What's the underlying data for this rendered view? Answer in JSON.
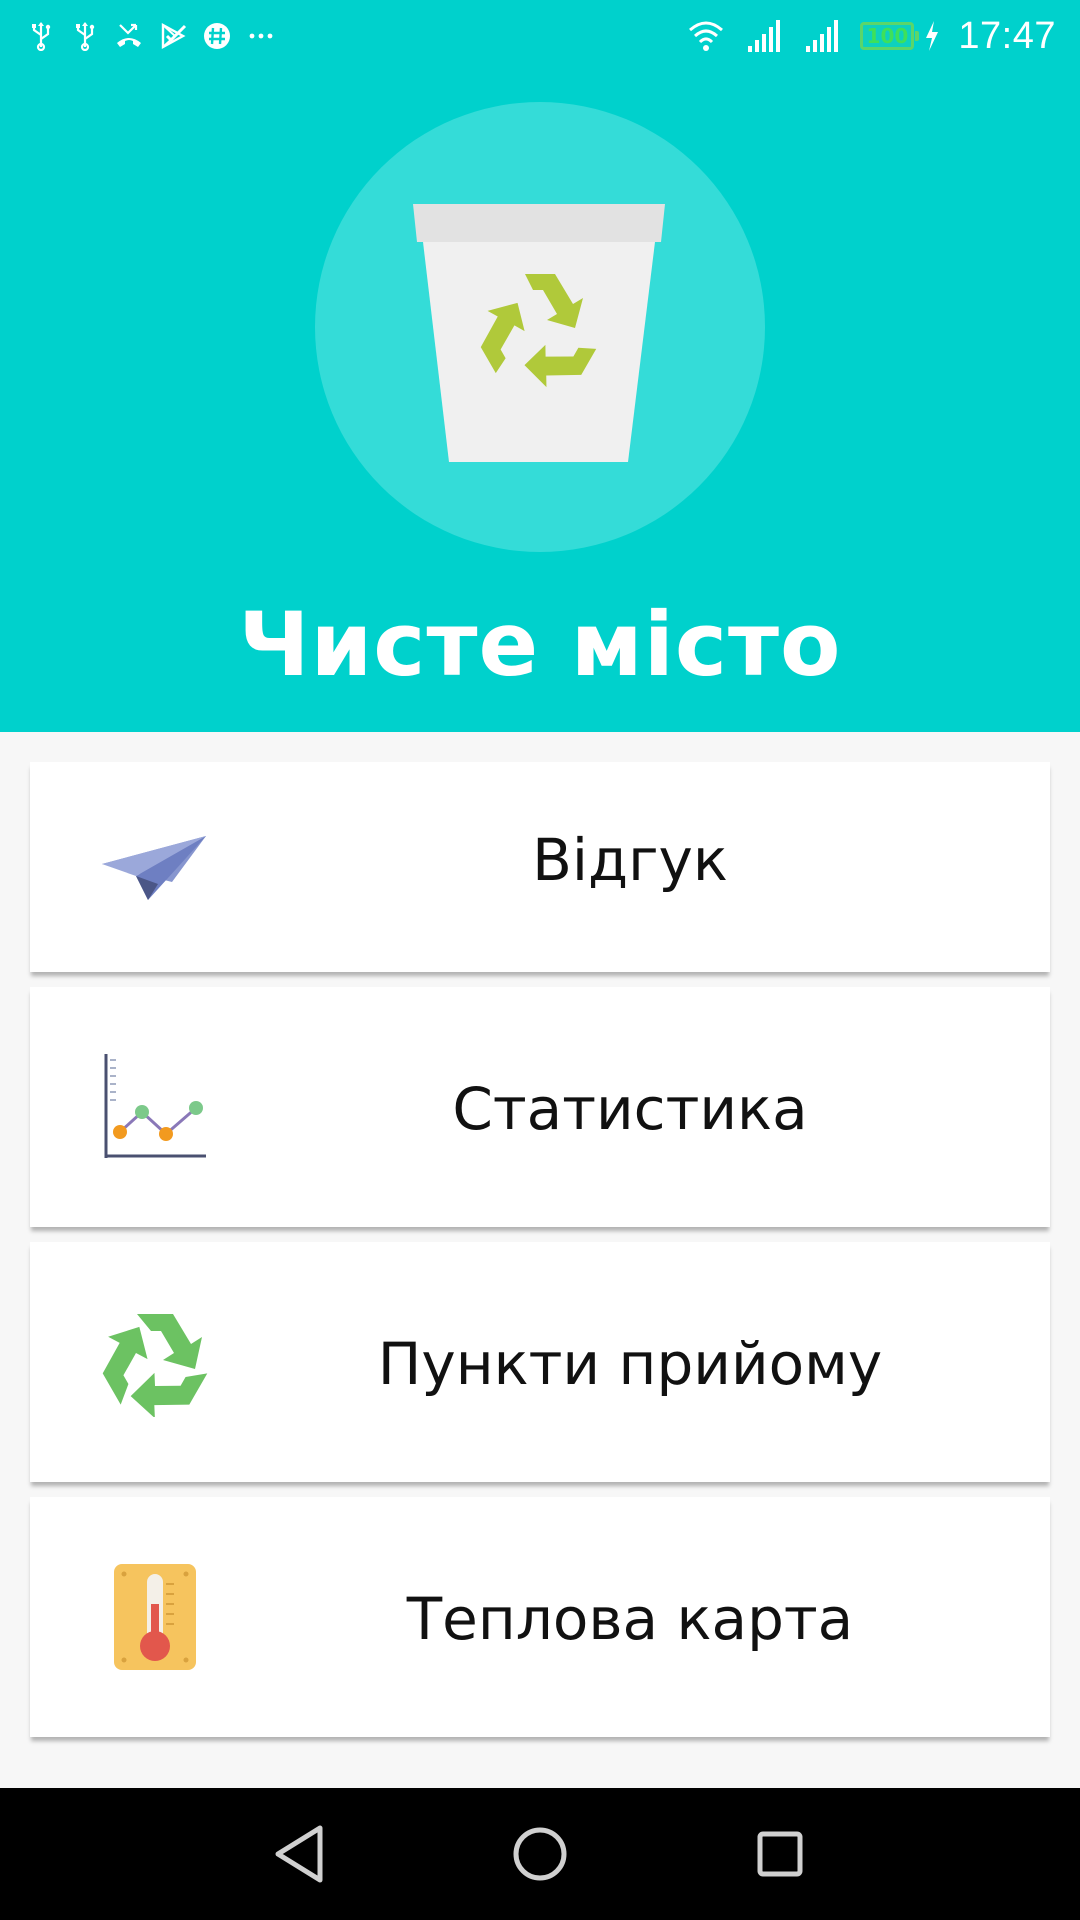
{
  "status_bar": {
    "time": "17:47",
    "battery": "100",
    "left_icons": [
      "usb-icon",
      "usb-icon",
      "missed-call-icon",
      "play-store-icon",
      "hashtag-icon",
      "more-notifications-icon"
    ],
    "right_icons": [
      "wifi-icon",
      "signal-icon",
      "signal-icon",
      "battery-icon",
      "charging-icon"
    ]
  },
  "header": {
    "background_color": "#00d1cc",
    "logo_icon": "recycle-bin-icon",
    "title": "Чисте місто"
  },
  "menu": {
    "items": [
      {
        "label": "Відгук",
        "icon": "paper-plane-icon"
      },
      {
        "label": "Статистика",
        "icon": "line-chart-icon"
      },
      {
        "label": "Пункти прийому",
        "icon": "recycle-icon"
      },
      {
        "label": "Теплова карта",
        "icon": "thermometer-icon"
      }
    ]
  },
  "nav_bar": {
    "buttons": [
      "back-icon",
      "home-icon",
      "recents-icon"
    ]
  }
}
